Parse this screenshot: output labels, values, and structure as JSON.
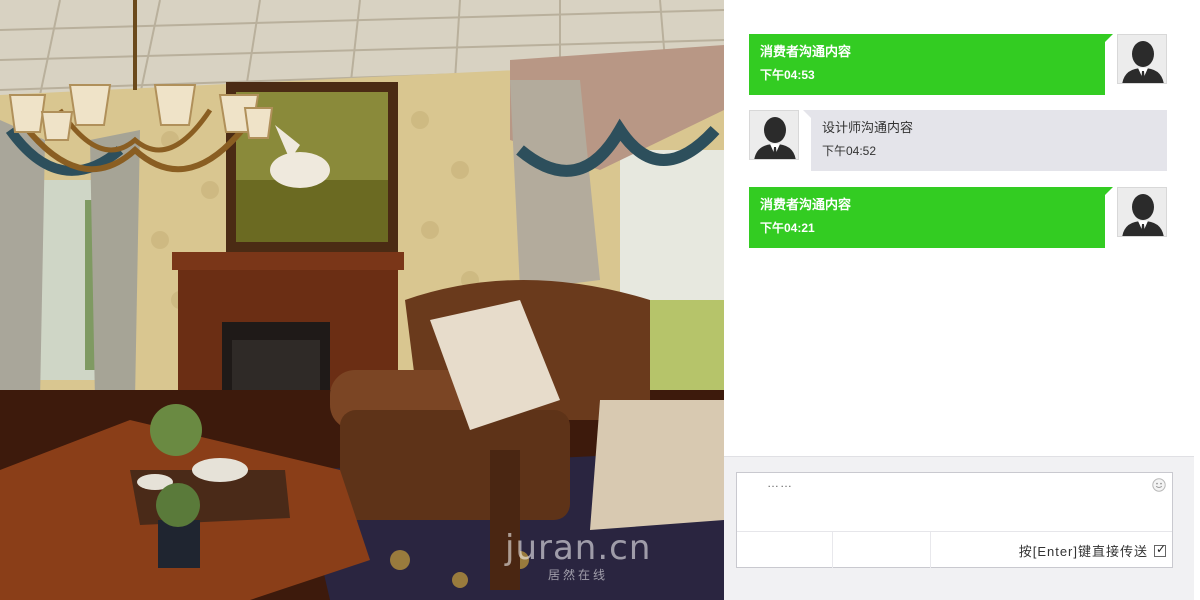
{
  "watermark": {
    "brand": "juran.cn",
    "sub": "居然在线"
  },
  "messages": [
    {
      "sender": "consumer",
      "text": "消费者沟通内容",
      "time": "下午04:53"
    },
    {
      "sender": "designer",
      "text": "设计师沟通内容",
      "time": "下午04:52"
    },
    {
      "sender": "consumer",
      "text": "消费者沟通内容",
      "time": "下午04:21"
    }
  ],
  "composer": {
    "placeholder": "……",
    "value": "",
    "send_hint": "按[Enter]键直接传送",
    "send_on_enter": true
  },
  "icons": {
    "avatar": "user-silhouette-icon",
    "emoji": "smiley-icon",
    "check": "checkbox-checked-icon"
  },
  "colors": {
    "consumer_bubble": "#33cc22",
    "designer_bubble": "#e4e4ea",
    "composer_bg": "#f1f1f3"
  }
}
